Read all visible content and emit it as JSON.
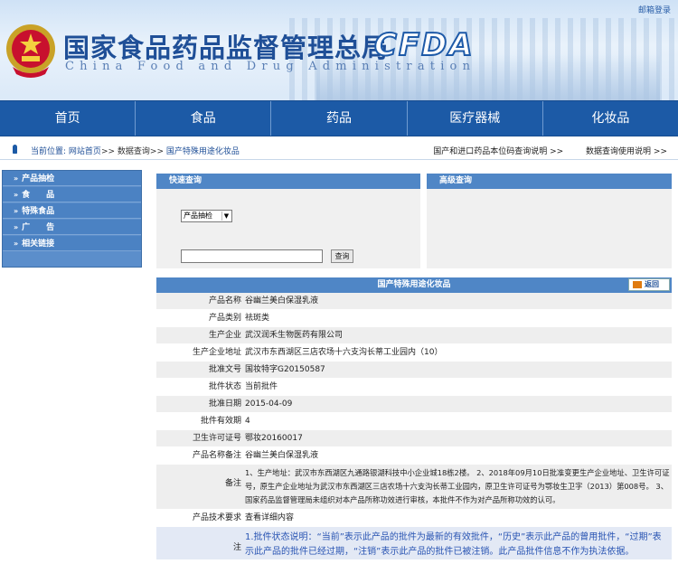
{
  "header": {
    "login_link": "邮箱登录",
    "title_cn": "国家食品药品监督管理总局",
    "title_en": "China Food and Drug Administration",
    "logo_text": "CFDA"
  },
  "nav": [
    "首页",
    "食品",
    "药品",
    "医疗器械",
    "化妆品"
  ],
  "breadcrumb": {
    "prefix": "当前位置:",
    "items": [
      "网站首页",
      "数据查询",
      "国产特殊用途化妆品"
    ],
    "sep": ">>"
  },
  "top_links": [
    "国产和进口药品本位码查询说明 >>",
    "数据查询使用说明 >>"
  ],
  "sidebar": {
    "items": [
      "产品抽检",
      "食　　品",
      "特殊食品",
      "广　　告",
      "相关链接"
    ]
  },
  "quick_query": {
    "title": "快速查询",
    "select_value": "产品抽检",
    "input_value": "",
    "button": "查询"
  },
  "advanced_query": {
    "title": "高级查询"
  },
  "detail": {
    "title": "国产特殊用途化妆品",
    "back_button": "返回",
    "rows": [
      {
        "label": "产品名称",
        "value": "谷幽兰美白保湿乳液"
      },
      {
        "label": "产品类别",
        "value": "祛斑类"
      },
      {
        "label": "生产企业",
        "value": "武汉润禾生物医药有限公司"
      },
      {
        "label": "生产企业地址",
        "value": "武汉市东西湖区三店农场十六支沟长蒂工业园内（10）"
      },
      {
        "label": "批准文号",
        "value": "国妆特字G20150587"
      },
      {
        "label": "批件状态",
        "value": "当前批件"
      },
      {
        "label": "批准日期",
        "value": "2015-04-09"
      },
      {
        "label": "批件有效期",
        "value": "4"
      },
      {
        "label": "卫生许可证号",
        "value": "鄂妆20160017"
      },
      {
        "label": "产品名称备注",
        "value": "谷幽兰美白保湿乳液"
      },
      {
        "label": "备注",
        "value": "1、生产地址：武汉市东西湖区九通路银湖科技中小企业城18栋2楼。 2、2018年09月10日批准变更生产企业地址、卫生许可证号，原生产企业地址为武汉市东西湖区三店农场十六支沟长蒂工业园内，原卫生许可证号为鄂妆生卫字（2013）第008号。 3、国家药品监督管理局未组织对本产品所称功效进行审核，本批件不作为对产品所称功效的认可。"
      },
      {
        "label": "产品技术要求",
        "value": "查看详细内容"
      },
      {
        "label": "注",
        "value": "1.批件状态说明：“当前”表示此产品的批件为最新的有效批件，“历史”表示此产品的曾用批件，“过期”表示此产品的批件已经过期，“注销”表示此产品的批件已被注销。此产品批件信息不作为执法依据。"
      }
    ]
  },
  "colors": {
    "nav_bg": "#1c5aa6",
    "panel_head": "#4f86c6",
    "note_text": "#2a55b3"
  }
}
